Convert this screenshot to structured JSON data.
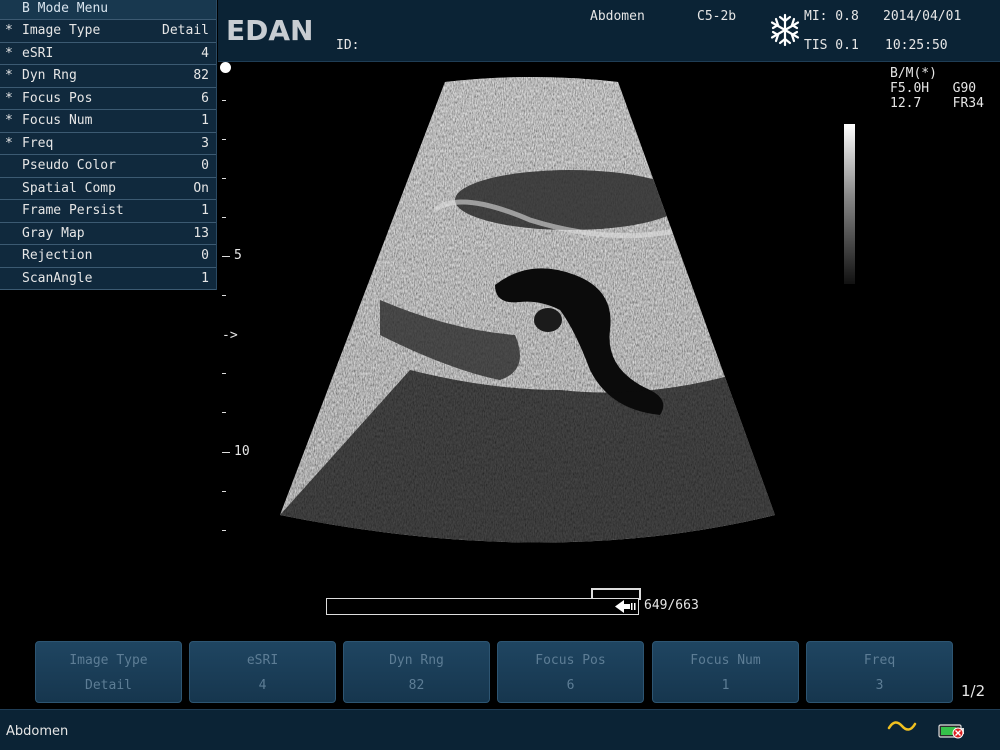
{
  "menu": {
    "title": "B Mode Menu",
    "items": [
      {
        "star": "*",
        "label": "Image Type",
        "value": "Detail"
      },
      {
        "star": "*",
        "label": "eSRI",
        "value": "4"
      },
      {
        "star": "*",
        "label": "Dyn Rng",
        "value": "82"
      },
      {
        "star": "*",
        "label": "Focus Pos",
        "value": "6"
      },
      {
        "star": "*",
        "label": "Focus Num",
        "value": "1"
      },
      {
        "star": "*",
        "label": "Freq",
        "value": "3"
      },
      {
        "star": "",
        "label": "Pseudo Color",
        "value": "0"
      },
      {
        "star": "",
        "label": "Spatial Comp",
        "value": "On"
      },
      {
        "star": "",
        "label": "Frame Persist",
        "value": "1"
      },
      {
        "star": "",
        "label": "Gray Map",
        "value": "13"
      },
      {
        "star": "",
        "label": "Rejection",
        "value": "0"
      },
      {
        "star": "",
        "label": "ScanAngle",
        "value": "1"
      }
    ]
  },
  "header": {
    "brand": "EDAN",
    "id_label": "ID:",
    "exam": "Abdomen",
    "probe": "C5-2b",
    "freeze_icon": "snowflake-icon",
    "mi": "MI: 0.8",
    "tis": "TIS 0.1",
    "date": "2014/04/01",
    "time": "10:25:50"
  },
  "image_params": {
    "mode": "B/M(*)",
    "line2_left": "F5.0H",
    "line2_right": "G90",
    "line3_left": "12.7",
    "line3_right": "FR34"
  },
  "depth_scale": {
    "labels": [
      "5",
      "10"
    ],
    "focus_marker": "->"
  },
  "cine": {
    "counter": "649/663",
    "position_fraction": 0.979
  },
  "softkeys": [
    {
      "label": "Image Type",
      "value": "Detail"
    },
    {
      "label": "eSRI",
      "value": "4"
    },
    {
      "label": "Dyn Rng",
      "value": "82"
    },
    {
      "label": "Focus Pos",
      "value": "6"
    },
    {
      "label": "Focus Num",
      "value": "1"
    },
    {
      "label": "Freq",
      "value": "3"
    }
  ],
  "page_indicator": "1/2",
  "status": {
    "exam": "Abdomen",
    "wave_icon": "wave-icon",
    "battery_icon": "battery-icon"
  },
  "colors": {
    "panel": "#10293d",
    "header": "#0b2335",
    "softkey": "#1f4561",
    "wave": "#f0c020"
  }
}
